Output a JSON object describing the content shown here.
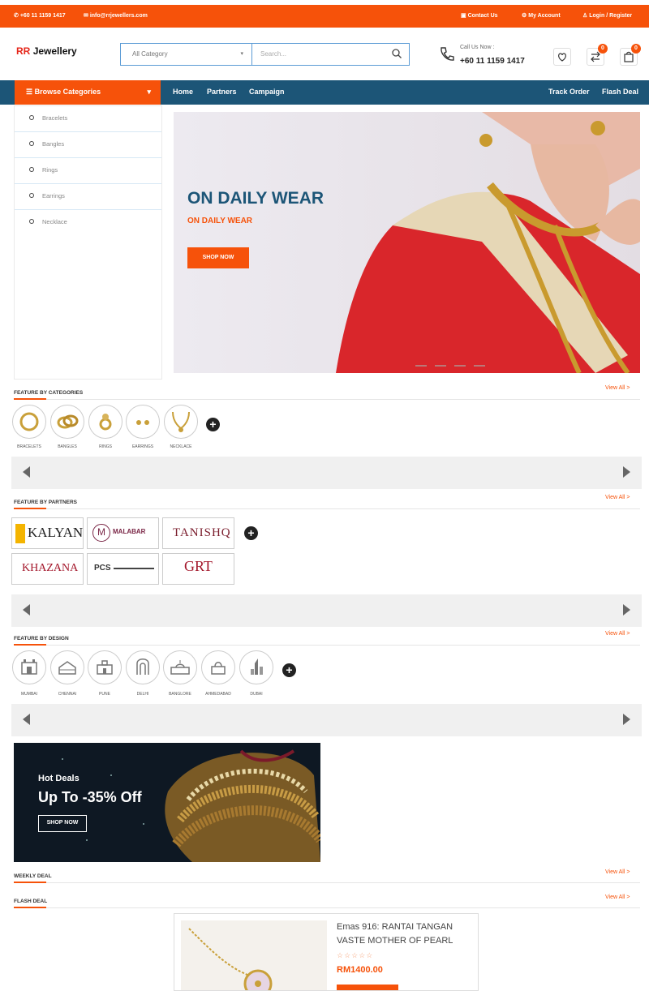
{
  "topbar": {
    "phone": "+60 11 1159 1417",
    "email": "info@rrjewellers.com",
    "contact": "Contact Us",
    "account": "My Account",
    "login": "Login / Register"
  },
  "header": {
    "logo_rr": "RR",
    "logo_text": "Jewellery",
    "category_select": "All Category",
    "search_placeholder": "Search...",
    "call_label": "Call Us Now :",
    "call_number": "+60 11 1159 1417",
    "wishlist_icon": "heart-icon",
    "compare_count": "0",
    "cart_count": "0"
  },
  "nav": {
    "browse": "Browse Categories",
    "links": [
      "Home",
      "Partners",
      "Campaign"
    ],
    "right_links": [
      "Track Order",
      "Flash Deal"
    ]
  },
  "categories": [
    "Bracelets",
    "Bangles",
    "Rings",
    "Earrings",
    "Necklace"
  ],
  "banner": {
    "title": "ON DAILY WEAR",
    "subtitle": "ON DAILY WEAR",
    "button": "SHOP NOW"
  },
  "feature_categories": {
    "title": "FEATURE BY CATEGORIES",
    "view_all": "View All >",
    "items": [
      "BRACELETS",
      "BANGLES",
      "RINGS",
      "EARRINGS",
      "NECKLACE"
    ]
  },
  "feature_partners": {
    "title": "FEATURE BY PARTNERS",
    "view_all": "View All >",
    "partners": [
      "KALYAN",
      "MALABAR",
      "TANISHQ",
      "KHAZANA",
      "PCS",
      "GRT"
    ]
  },
  "feature_design": {
    "title": "FEATURE BY DESIGN",
    "view_all": "View All >",
    "items": [
      "MUMBAI",
      "CHENNAI",
      "PUNE",
      "DELHI",
      "BANGLORE",
      "AHMEDABAD",
      "DUBAI"
    ]
  },
  "hot_deals": {
    "label": "Hot Deals",
    "headline": "Up To -35% Off",
    "button": "SHOP NOW"
  },
  "weekly_deal": {
    "title": "WEEKLY DEAL",
    "view_all": "View All >"
  },
  "flash_deal": {
    "title": "FLASH DEAL",
    "view_all": "View All >"
  },
  "product": {
    "title": "Emas 916: RANTAI TANGAN VASTE MOTHER OF PEARL",
    "stars": "☆☆☆☆☆",
    "price": "RM1400.00"
  },
  "colors": {
    "accent": "#f6520a",
    "nav": "#1c5577"
  }
}
